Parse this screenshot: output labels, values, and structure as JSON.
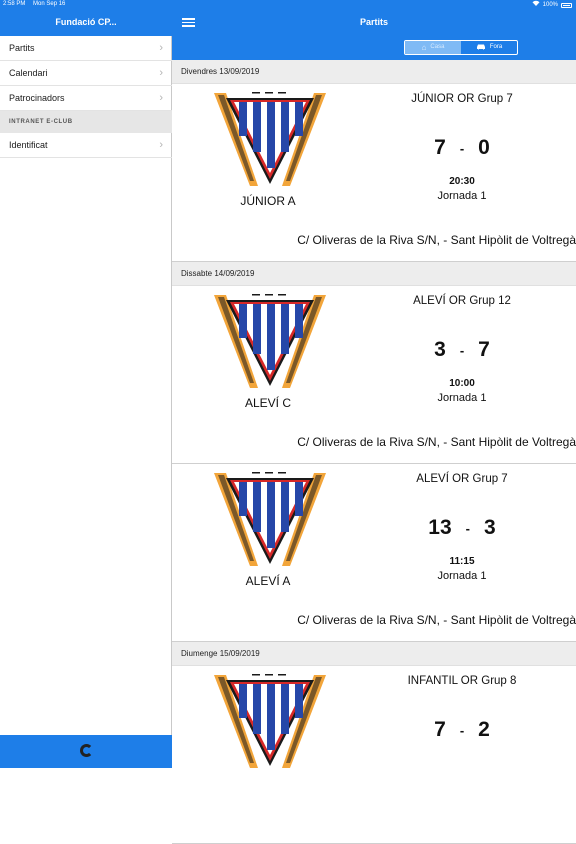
{
  "status_bar": {
    "time": "2:58 PM",
    "date": "Mon Sep 16",
    "battery": "100%"
  },
  "sidebar": {
    "title": "Fundació CP...",
    "items": [
      {
        "label": "Partits"
      },
      {
        "label": "Calendari"
      },
      {
        "label": "Patrocinadors"
      }
    ],
    "section": "INTRANET E-CLUB",
    "section_items": [
      {
        "label": "Identificat"
      }
    ]
  },
  "navbar": {
    "title": "Partits",
    "segments": [
      {
        "label": "Casa",
        "icon": "house-icon",
        "active": true
      },
      {
        "label": "Fora",
        "icon": "car-icon",
        "active": false
      }
    ]
  },
  "colors": {
    "accent": "#1e7ee8",
    "segment_active": "#7fbaf5",
    "day_header": "#ededed"
  },
  "days": [
    {
      "date": "Divendres 13/09/2019",
      "matches": [
        {
          "team": "JÚNIOR A",
          "league": "JÚNIOR OR Grup 7",
          "home": "7",
          "away": "0",
          "time": "20:30",
          "round": "Jornada 1",
          "address": "C/ Oliveras de la Riva S/N, - Sant Hipòlit de Voltregà"
        }
      ]
    },
    {
      "date": "Dissabte 14/09/2019",
      "matches": [
        {
          "team": "ALEVÍ C",
          "league": "ALEVÍ OR Grup 12",
          "home": "3",
          "away": "7",
          "time": "10:00",
          "round": "Jornada 1",
          "address": "C/ Oliveras de la Riva S/N, - Sant Hipòlit de Voltregà"
        },
        {
          "team": "ALEVÍ A",
          "league": "ALEVÍ OR Grup 7",
          "home": "13",
          "away": "3",
          "time": "11:15",
          "round": "Jornada 1",
          "address": "C/ Oliveras de la Riva S/N, - Sant Hipòlit de Voltregà"
        }
      ]
    },
    {
      "date": "Diumenge 15/09/2019",
      "matches": [
        {
          "team": "",
          "league": "INFANTIL OR Grup 8",
          "home": "7",
          "away": "2",
          "time": "",
          "round": "",
          "address": ""
        }
      ]
    }
  ]
}
